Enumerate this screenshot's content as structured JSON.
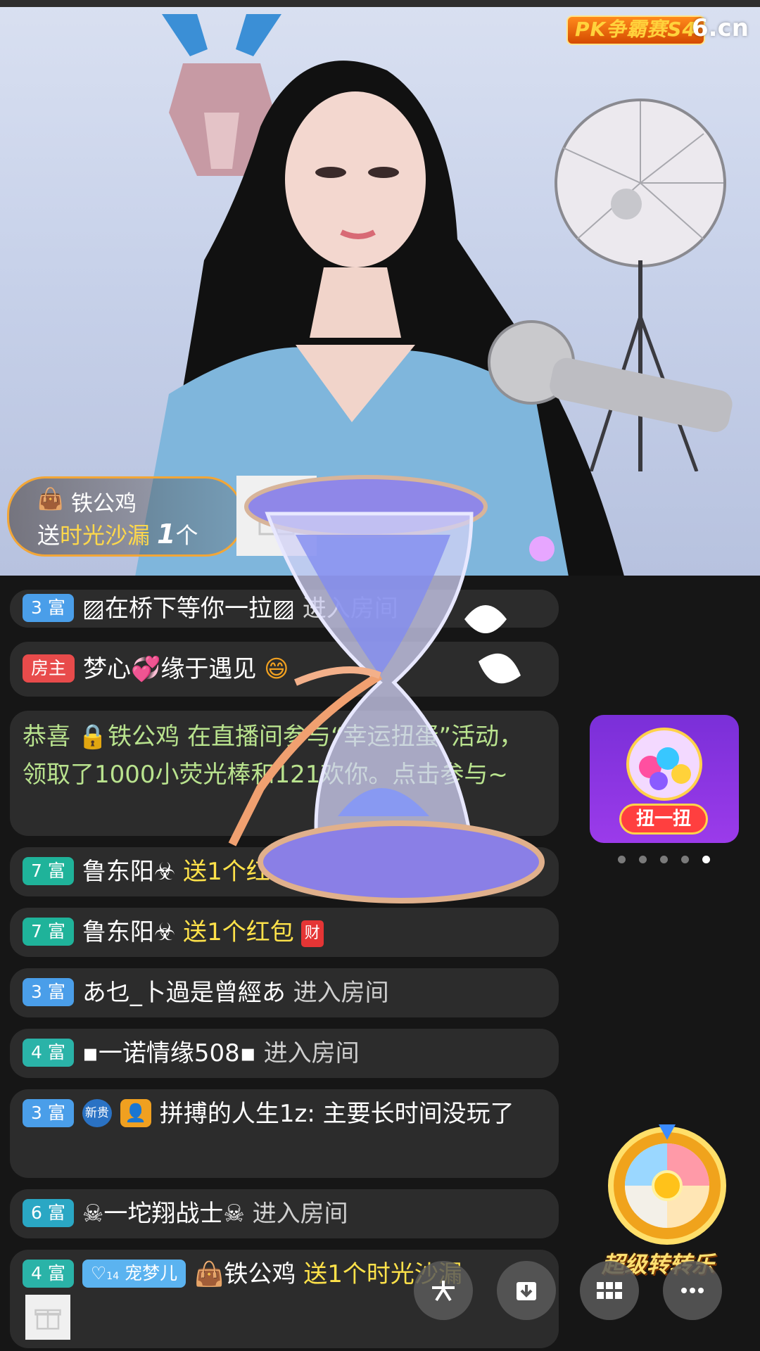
{
  "stream": {
    "event_logo": "PK争霸赛S4",
    "site_logo": "6.cn"
  },
  "gift_banner": {
    "user": "铁公鸡",
    "prefix": "送",
    "gift_name": "时光沙漏",
    "count": "1",
    "unit": "个"
  },
  "chat": [
    {
      "badge": "3 富",
      "badge_class": "b3",
      "name": "▨在桥下等你一拉▨",
      "action": "进入房间"
    },
    {
      "badge": "房主",
      "badge_class": "bhost",
      "name": "梦心💞缘于遇见",
      "action": ""
    },
    {
      "text": "恭喜 🔒铁公鸡 在直播间参与“幸运扭蛋”活动，领取了1000小荧光棒和121欢你。点击参与~"
    },
    {
      "badge": "7 富",
      "badge_class": "b7",
      "name": "鲁东阳☣",
      "action": "送1个红包",
      "tag": "财"
    },
    {
      "badge": "7 富",
      "badge_class": "b7",
      "name": "鲁东阳☣",
      "action": "送1个红包",
      "tag": "财"
    },
    {
      "badge": "3 富",
      "badge_class": "b3",
      "name": "あ乜_卜過是曾經あ",
      "action": "进入房间"
    },
    {
      "badge": "4 富",
      "badge_class": "b4",
      "name": "▪一诺情缘508▪",
      "action": "进入房间"
    },
    {
      "badge": "3 富",
      "badge_class": "b3",
      "name": "拼搏的人生1z:",
      "action": "主要长时间没玩了",
      "new_label": "新贵"
    },
    {
      "badge": "6 富",
      "badge_class": "b6",
      "name": "☠一坨翔战士☠",
      "action": "进入房间"
    },
    {
      "badge": "4 富",
      "badge_class": "b4",
      "name": "铁公鸡",
      "action": "送1个时光沙漏",
      "pet": "宠梦儿",
      "pet_level": "14"
    }
  ],
  "gacha": {
    "button_label": "扭一扭",
    "carousel_pages": 5,
    "active_page": 5
  },
  "wheel": {
    "label": "超级转转乐"
  },
  "colors": {
    "accent_gold": "#ffe24a",
    "host_red": "#e84b4b",
    "banner_border": "#f2a637",
    "gacha_purple": "#8a35e0"
  }
}
